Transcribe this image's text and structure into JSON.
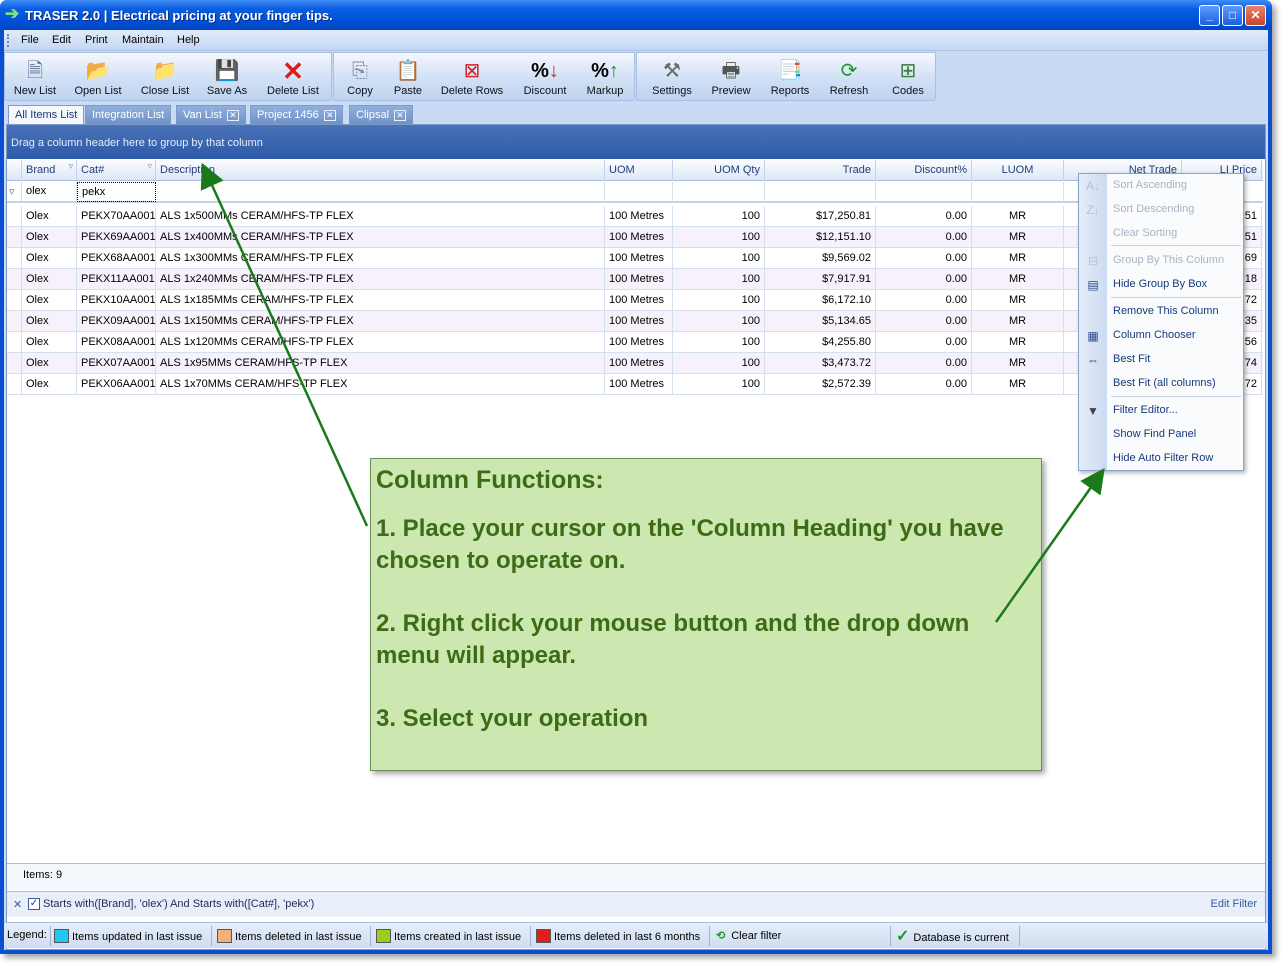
{
  "window": {
    "title": "TRASER 2.0  |  Electrical pricing at your finger tips."
  },
  "menu": [
    "File",
    "Edit",
    "Print",
    "Maintain",
    "Help"
  ],
  "toolbar": [
    {
      "label": "New List",
      "icon": "new-list-icon"
    },
    {
      "label": "Open List",
      "icon": "open-folder-icon"
    },
    {
      "label": "Close List",
      "icon": "close-folder-icon"
    },
    {
      "label": "Save As",
      "icon": "save-disk-icon"
    },
    {
      "label": "Delete List",
      "icon": "red-x-icon"
    },
    {
      "label": "Copy",
      "icon": "copy-icon"
    },
    {
      "label": "Paste",
      "icon": "paste-icon"
    },
    {
      "label": "Delete Rows",
      "icon": "delete-rows-icon"
    },
    {
      "label": "Discount",
      "icon": "percent-down-icon"
    },
    {
      "label": "Markup",
      "icon": "percent-up-icon"
    },
    {
      "label": "Settings",
      "icon": "tools-icon"
    },
    {
      "label": "Preview",
      "icon": "printer-preview-icon"
    },
    {
      "label": "Reports",
      "icon": "reports-icon"
    },
    {
      "label": "Refresh",
      "icon": "refresh-icon"
    },
    {
      "label": "Codes",
      "icon": "codes-icon"
    }
  ],
  "tabs": [
    {
      "label": "All Items List",
      "active": true,
      "closable": false
    },
    {
      "label": "Integration List",
      "active": false,
      "closable": false
    },
    {
      "label": "Van List",
      "active": false,
      "closable": true
    },
    {
      "label": "Project 1456",
      "active": false,
      "closable": true
    },
    {
      "label": "Clipsal",
      "active": false,
      "closable": true
    }
  ],
  "grid": {
    "group_prompt": "Drag a column header here to group by that column",
    "columns": [
      "Brand",
      "Cat#",
      "Description",
      "UOM",
      "UOM Qty",
      "Trade",
      "Discount%",
      "LUOM",
      "Net Trade",
      "LI Price"
    ],
    "filters": {
      "brand": "olex",
      "cat": "pekx"
    },
    "rows": [
      {
        "brand": "Olex",
        "cat": "PEKX70AA001",
        "desc": "ALS 1x500MMs CERAM/HFS-TP FLEX",
        "uom": "100 Metres",
        "qty": "100",
        "trade": "$17,250.81",
        "disc": "0.00",
        "luom": "MR",
        "li": ".51"
      },
      {
        "brand": "Olex",
        "cat": "PEKX69AA001",
        "desc": "ALS 1x400MMs CERAM/HFS-TP FLEX",
        "uom": "100 Metres",
        "qty": "100",
        "trade": "$12,151.10",
        "disc": "0.00",
        "luom": "MR",
        "li": ".51"
      },
      {
        "brand": "Olex",
        "cat": "PEKX68AA001",
        "desc": "ALS 1x300MMs CERAM/HFS-TP FLEX",
        "uom": "100 Metres",
        "qty": "100",
        "trade": "$9,569.02",
        "disc": "0.00",
        "luom": "MR",
        "li": ".69"
      },
      {
        "brand": "Olex",
        "cat": "PEKX11AA001",
        "desc": "ALS 1x240MMs CERAM/HFS-TP FLEX",
        "uom": "100 Metres",
        "qty": "100",
        "trade": "$7,917.91",
        "disc": "0.00",
        "luom": "MR",
        "li": ".18"
      },
      {
        "brand": "Olex",
        "cat": "PEKX10AA001",
        "desc": "ALS 1x185MMs CERAM/HFS-TP FLEX",
        "uom": "100 Metres",
        "qty": "100",
        "trade": "$6,172.10",
        "disc": "0.00",
        "luom": "MR",
        "li": ".72"
      },
      {
        "brand": "Olex",
        "cat": "PEKX09AA001",
        "desc": "ALS 1x150MMs CERAM/HFS-TP FLEX",
        "uom": "100 Metres",
        "qty": "100",
        "trade": "$5,134.65",
        "disc": "0.00",
        "luom": "MR",
        "li": ".35"
      },
      {
        "brand": "Olex",
        "cat": "PEKX08AA001",
        "desc": "ALS 1x120MMs CERAM/HFS-TP FLEX",
        "uom": "100 Metres",
        "qty": "100",
        "trade": "$4,255.80",
        "disc": "0.00",
        "luom": "MR",
        "li": ".56"
      },
      {
        "brand": "Olex",
        "cat": "PEKX07AA001",
        "desc": "ALS 1x95MMs CERAM/HFS-TP FLEX",
        "uom": "100 Metres",
        "qty": "100",
        "trade": "$3,473.72",
        "disc": "0.00",
        "luom": "MR",
        "li": ".74"
      },
      {
        "brand": "Olex",
        "cat": "PEKX06AA001",
        "desc": "ALS 1x70MMs CERAM/HFS-TP FLEX",
        "uom": "100 Metres",
        "qty": "100",
        "trade": "$2,572.39",
        "disc": "0.00",
        "luom": "MR",
        "li": ".72"
      }
    ],
    "items_count": "Items: 9",
    "filter_expression": "Starts with([Brand], 'olex') And Starts with([Cat#], 'pekx')",
    "edit_filter": "Edit Filter"
  },
  "context_menu": [
    {
      "label": "Sort Ascending",
      "disabled": true
    },
    {
      "label": "Sort Descending",
      "disabled": true
    },
    {
      "label": "Clear Sorting",
      "disabled": true
    },
    {
      "label": "Group By This Column",
      "disabled": true
    },
    {
      "label": "Hide Group By Box",
      "disabled": false
    },
    {
      "label": "Remove This Column",
      "disabled": false
    },
    {
      "label": "Column Chooser",
      "disabled": false
    },
    {
      "label": "Best Fit",
      "disabled": false
    },
    {
      "label": "Best Fit (all columns)",
      "disabled": false
    },
    {
      "label": "Filter Editor...",
      "disabled": false
    },
    {
      "label": "Show Find Panel",
      "disabled": false
    },
    {
      "label": "Hide Auto Filter Row",
      "disabled": false
    }
  ],
  "legend": {
    "label": "Legend:",
    "items": [
      {
        "label": "Items updated in last issue",
        "color": "#1ec8f0"
      },
      {
        "label": "Items deleted in last issue",
        "color": "#f5b07a"
      },
      {
        "label": "Items created in last issue",
        "color": "#9acd1e"
      },
      {
        "label": "Items deleted in last 6 months",
        "color": "#e21d1d"
      }
    ],
    "clear_filter": "Clear filter",
    "db_status": "Database is current"
  },
  "note": {
    "title": "Column Functions:",
    "p1": "1. Place your cursor on the 'Column Heading' you have chosen to operate on.",
    "p2": "2. Right click your mouse button and the drop down menu will appear.",
    "p3": "3. Select your operation"
  }
}
